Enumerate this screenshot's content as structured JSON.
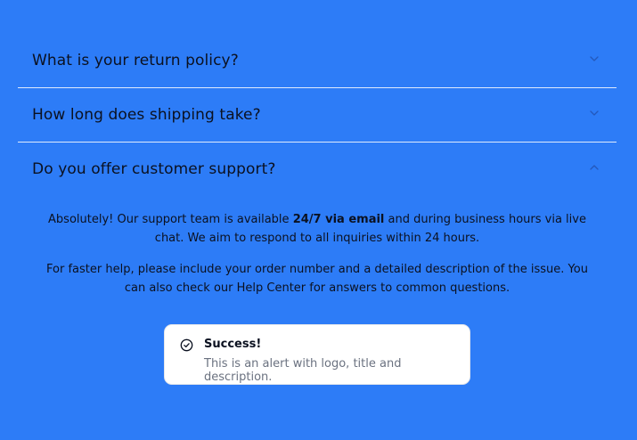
{
  "faq": {
    "items": [
      {
        "question": "What is your return policy?",
        "expanded": false
      },
      {
        "question": "How long does shipping take?",
        "expanded": false
      },
      {
        "question": "Do you offer customer support?",
        "expanded": true,
        "answer_p1_before": "Absolutely! Our support team is available ",
        "answer_p1_bold": "24/7 via email",
        "answer_p1_after": " and during business hours via live chat. We aim to respond to all inquiries within 24 hours.",
        "answer_p2": "For faster help, please include your order number and a detailed description of the issue. You can also check our Help Center for answers to common questions."
      }
    ]
  },
  "alert": {
    "icon": "check-circle-icon",
    "title": "Success!",
    "description": "This is an alert with logo, title and description."
  },
  "colors": {
    "background": "#2d7cf7",
    "text": "#0b1120",
    "alert_bg": "#ffffff",
    "alert_desc": "#6b7280"
  }
}
